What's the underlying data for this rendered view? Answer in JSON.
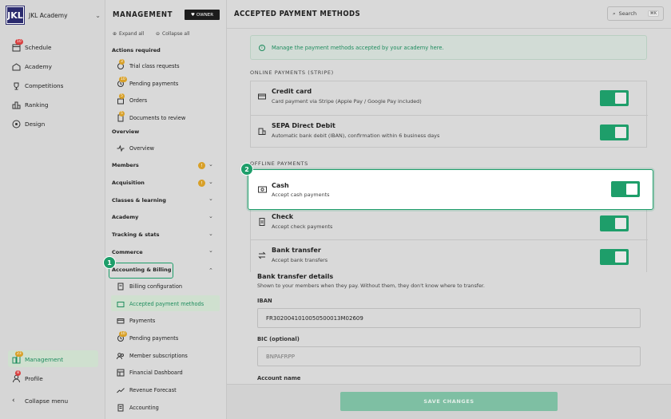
{
  "org": {
    "logo": "JKL",
    "name": "JKL Academy"
  },
  "sidebar": {
    "items": [
      {
        "label": "Schedule",
        "badge": "10"
      },
      {
        "label": "Academy"
      },
      {
        "label": "Competitions"
      },
      {
        "label": "Ranking"
      },
      {
        "label": "Design"
      }
    ],
    "management": {
      "label": "Management",
      "badge": "23"
    },
    "profile": {
      "label": "Profile",
      "badge": "8"
    },
    "collapse": "Collapse menu"
  },
  "nav": {
    "title": "MANAGEMENT",
    "owner": "OWNER",
    "expand_all": "Expand all",
    "collapse_all": "Collapse all",
    "actions_required": "Actions required",
    "actions": [
      {
        "label": "Trial class requests",
        "badge": "3"
      },
      {
        "label": "Pending payments",
        "badge": "10"
      },
      {
        "label": "Orders",
        "badge": "5"
      },
      {
        "label": "Documents to review",
        "badge": "5"
      }
    ],
    "overview_head": "Overview",
    "overview": "Overview",
    "sections": [
      {
        "label": "Members",
        "badge": "!"
      },
      {
        "label": "Acquisition",
        "badge": "!"
      },
      {
        "label": "Classes & learning"
      },
      {
        "label": "Academy"
      },
      {
        "label": "Tracking & stats"
      },
      {
        "label": "Commerce"
      },
      {
        "label": "Accounting & Billing"
      }
    ],
    "billing": [
      {
        "label": "Billing configuration"
      },
      {
        "label": "Accepted payment methods"
      },
      {
        "label": "Payments"
      },
      {
        "label": "Pending payments",
        "badge": "10"
      },
      {
        "label": "Member subscriptions"
      },
      {
        "label": "Financial Dashboard"
      },
      {
        "label": "Revenue Forecast"
      },
      {
        "label": "Accounting"
      }
    ]
  },
  "steps": [
    "1",
    "2"
  ],
  "main": {
    "title": "ACCEPTED PAYMENT METHODS",
    "search": "Search",
    "search_kbd": "⌘K",
    "info": "Manage the payment methods accepted by your academy here.",
    "online_head": "ONLINE PAYMENTS (STRIPE)",
    "online": [
      {
        "title": "Credit card",
        "sub": "Card payment via Stripe (Apple Pay / Google Pay included)",
        "enabled": true
      },
      {
        "title": "SEPA Direct Debit",
        "sub": "Automatic bank debit (IBAN), confirmation within 6 business days",
        "enabled": true
      }
    ],
    "offline_head": "OFFLINE PAYMENTS",
    "offline": [
      {
        "title": "Cash",
        "sub": "Accept cash payments",
        "enabled": true
      },
      {
        "title": "Check",
        "sub": "Accept check payments",
        "enabled": true
      },
      {
        "title": "Bank transfer",
        "sub": "Accept bank transfers",
        "enabled": true
      }
    ],
    "bank_details_title": "Bank transfer details",
    "bank_details_sub": "Shown to your members when they pay. Without them, they don't know where to transfer.",
    "iban_label": "IBAN",
    "iban_value": "FR3020041010050500013M02609",
    "bic_label": "BIC (optional)",
    "bic_placeholder": "BNPAFRPP",
    "account_label": "Account name",
    "save": "SAVE CHANGES"
  },
  "colors": {
    "accent": "#1e9e6a",
    "badge_red": "#d84040",
    "badge_orange": "#d8a028"
  }
}
